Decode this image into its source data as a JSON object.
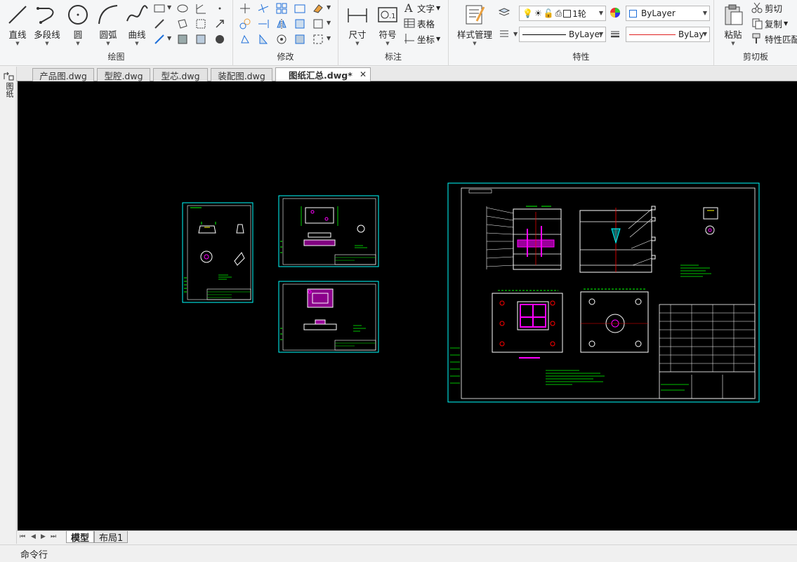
{
  "ribbon": {
    "draw": {
      "title": "绘图",
      "line": "直线",
      "polyline": "多段线",
      "circle": "圆",
      "arc": "圆弧",
      "spline": "曲线"
    },
    "modify": {
      "title": "修改"
    },
    "annotate": {
      "title": "标注",
      "dimension": "尺寸",
      "symbol": "符号",
      "text": "文字",
      "table": "表格",
      "coordinate": "坐标"
    },
    "properties": {
      "title": "特性",
      "style_manager": "样式管理",
      "layer_value": "1轮",
      "color_value": "ByLayer",
      "linetype_value": "ByLayer",
      "lineweight_value": "ByLay"
    },
    "clipboard": {
      "title": "剪切板",
      "paste": "粘贴",
      "cut": "剪切",
      "copy": "复制",
      "match_props": "特性匹配"
    }
  },
  "tabs": [
    {
      "label": "产品图.dwg"
    },
    {
      "label": "型腔.dwg"
    },
    {
      "label": "型芯.dwg"
    },
    {
      "label": "装配图.dwg"
    },
    {
      "label": "图纸汇总.dwg*",
      "active": true
    }
  ],
  "left_strip_label": "图纸",
  "layout_tabs": [
    {
      "label": "模型",
      "active": true
    },
    {
      "label": "布局1"
    }
  ],
  "command_line": "命令行",
  "colors": {
    "canvas_bg": "#000000",
    "frame_cyan": "#00ffff",
    "dim_green": "#00ff00",
    "highlight_magenta": "#ff00ff",
    "line_white": "#ffffff",
    "line_red": "#ff0000",
    "accent_blue": "#1e6fd9"
  }
}
